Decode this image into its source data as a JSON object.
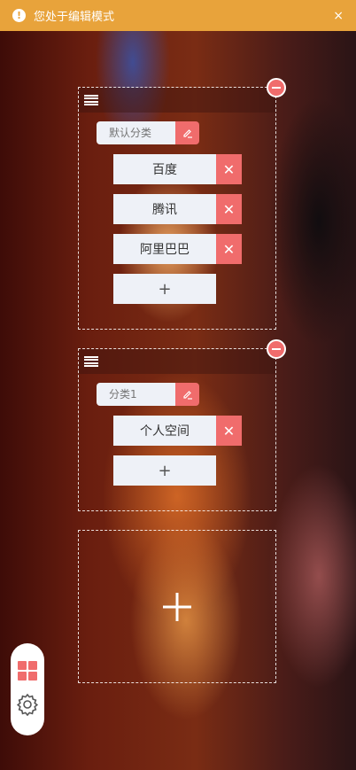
{
  "notice": {
    "text": "您处于编辑模式",
    "close_label": "×"
  },
  "groups": [
    {
      "category_placeholder": "默认分类",
      "sites": [
        {
          "label": "百度",
          "delete_label": "✕"
        },
        {
          "label": "腾讯",
          "delete_label": "✕"
        },
        {
          "label": "阿里巴巴",
          "delete_label": "✕"
        }
      ],
      "add_site_label": "+"
    },
    {
      "category_placeholder": "分类1",
      "sites": [
        {
          "label": "个人空间",
          "delete_label": "✕"
        }
      ],
      "add_site_label": "+"
    }
  ],
  "icons": {
    "notice": "exclamation-circle-icon",
    "drag": "menu-lines-icon",
    "remove_group": "minus-circle-icon",
    "edit": "pencil-icon",
    "add_group": "plus-icon",
    "dock_grid": "grid-icon",
    "dock_settings": "gear-icon"
  },
  "colors": {
    "notice_bg": "#e8a33b",
    "accent_red": "#f06c6c",
    "item_bg": "#eef1f7"
  }
}
